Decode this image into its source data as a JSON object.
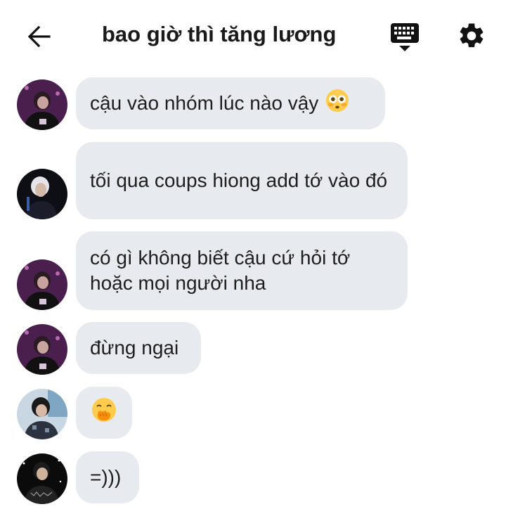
{
  "header": {
    "title": "bao giờ thì tăng lương",
    "back_icon": "arrow-left-icon",
    "keyboard_icon": "keyboard-icon",
    "settings_icon": "gear-icon"
  },
  "messages": [
    {
      "text": "cậu vào nhóm lúc nào vậy",
      "emoji": "flushed-face"
    },
    {
      "text": "tối qua coups hiong add tớ vào đó"
    },
    {
      "text": "có gì không biết cậu cứ hỏi tớ hoặc mọi người nha"
    },
    {
      "text": "đừng ngại"
    },
    {
      "text": "",
      "emoji": "face-with-hand-over-mouth"
    },
    {
      "text": "=)))"
    }
  ],
  "colors": {
    "bubble": "#e7ebf0",
    "avatar_purple": "#5a2a5c",
    "avatar_dark": "#151515"
  }
}
